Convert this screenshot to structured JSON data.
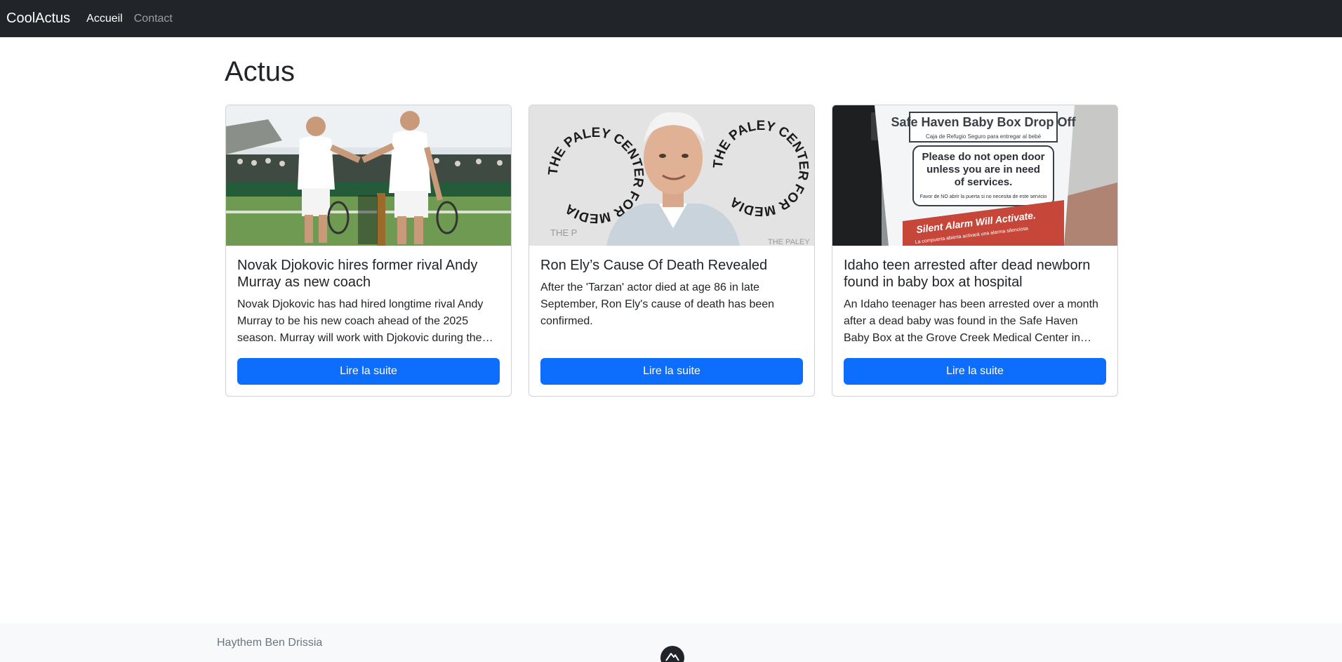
{
  "navbar": {
    "brand": "CoolActus",
    "links": [
      {
        "label": "Accueil",
        "active": true
      },
      {
        "label": "Contact",
        "active": false
      }
    ]
  },
  "main": {
    "title": "Actus",
    "articles": [
      {
        "title": "Novak Djokovic hires former rival Andy Murray as new coach",
        "description": "Novak Djokovic has had hired longtime rival Andy Murray to be his new coach ahead of the 2025 season. Murray will work with Djokovic during the offseason and at the Australian Open.",
        "button_label": "Lire la suite",
        "image_subject": "two-tennis-players-shaking-hands"
      },
      {
        "title": "Ron Ely’s Cause Of Death Revealed",
        "description": "After the 'Tarzan' actor died at age 86 in late September, Ron Ely's cause of death has been confirmed.",
        "button_label": "Lire la suite",
        "image_subject": "portrait-at-paley-center-backdrop",
        "image_text": [
          "THE PALEY CENTER FOR MEDIA",
          "THE PALEY CENTER FOR MEDIA",
          "THE P",
          "THE PALEY"
        ]
      },
      {
        "title": "Idaho teen arrested after dead newborn found in baby box at hospital",
        "description": "An Idaho teenager has been arrested over a month after a dead baby was found in the Safe Haven Baby Box at the Grove Creek Medical Center in Blackfoot.",
        "button_label": "Lire la suite",
        "image_subject": "safe-haven-baby-box-sign",
        "image_text": {
          "heading": "Safe Haven Baby Box Drop Off",
          "spanish": "Caja de Refugio Seguro para entregar al bebé",
          "warning_line1": "Please do not open door",
          "warning_line2": "unless you are in need",
          "warning_line3": "of services.",
          "warning_spanish": "Favor de NO abrir la puerta si no necesita de este servicio",
          "alarm": "Silent Alarm Will Activate.",
          "alarm_spanish": "La compuerta abierta activará una alarma silenciosa"
        }
      }
    ]
  },
  "footer": {
    "author": "Haythem Ben Drissia"
  },
  "colors": {
    "navbar_bg": "#212529",
    "button_bg": "#0d6efd",
    "footer_bg": "#f8f9fa"
  }
}
